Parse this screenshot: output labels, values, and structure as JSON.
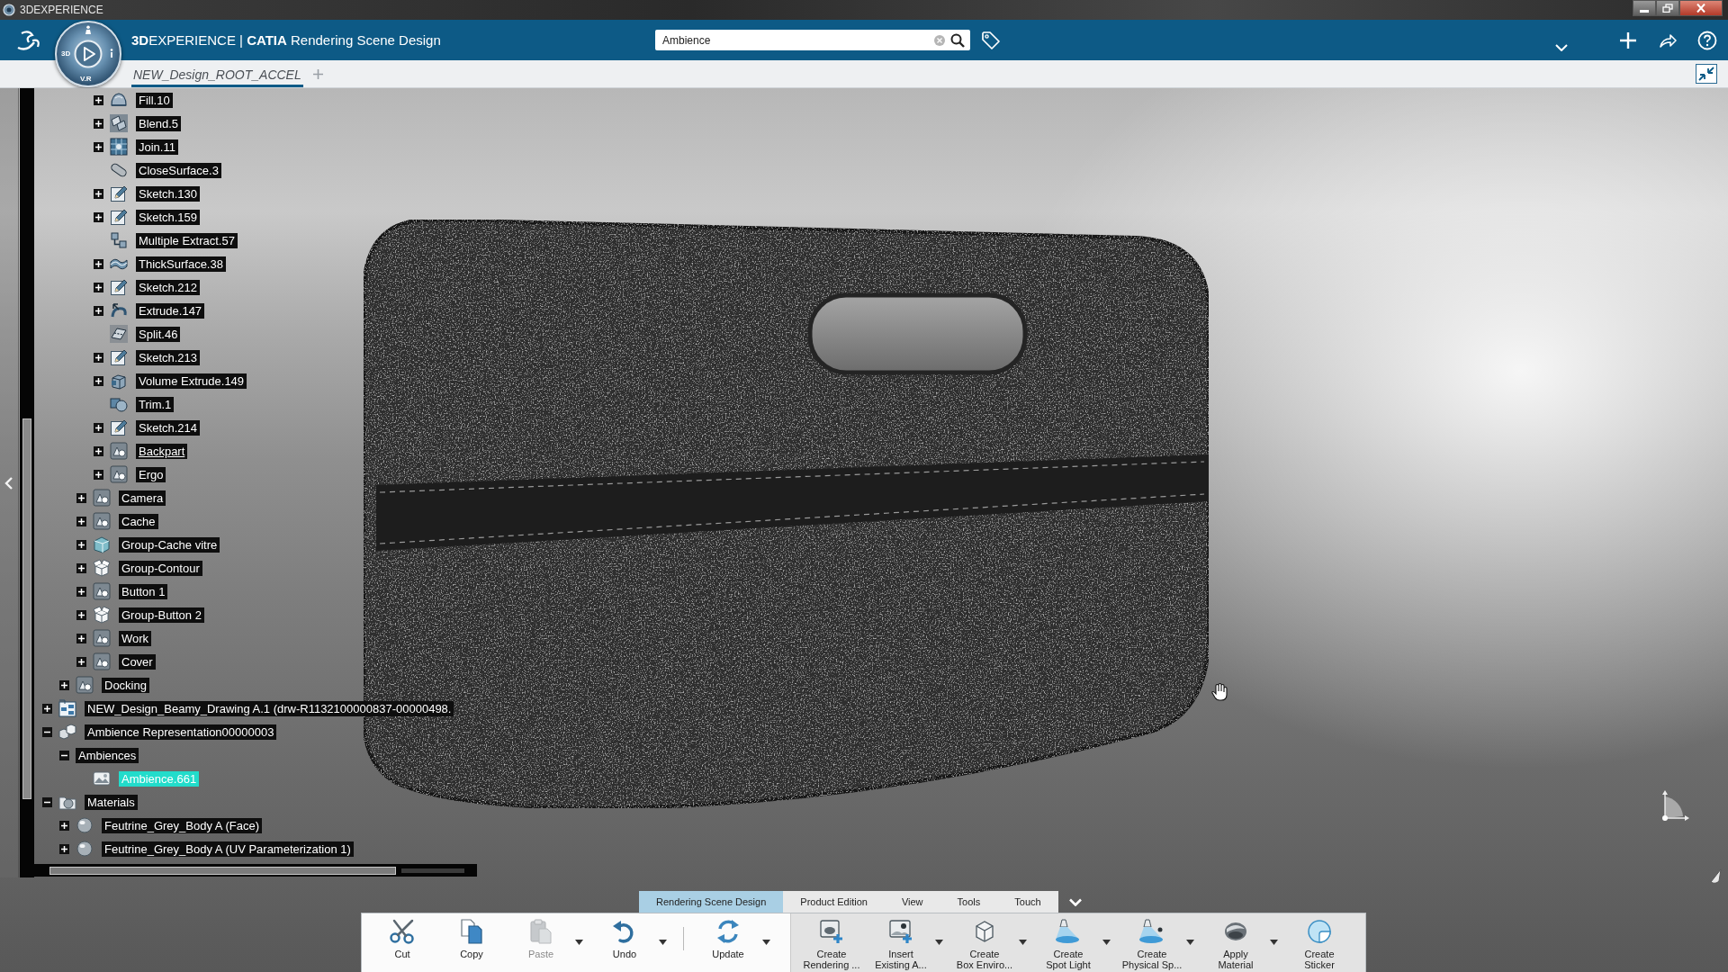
{
  "window": {
    "title": "3DEXPERIENCE"
  },
  "header": {
    "title": "**3D**EXPERIENCE | **CATIA** Rendering Scene Design",
    "search": {
      "value": "Ambience"
    }
  },
  "compass": {
    "left_label": "3D",
    "bottom_label": "V.R"
  },
  "document_tabs": [
    {
      "label": "NEW_Design_ROOT_ACCEL",
      "selected": true
    }
  ],
  "tree": {
    "items": [
      {
        "children": [
          {
            "children": [
              {
                "children": [
                  {
                    "label": "Fill.10",
                    "kind": "fill",
                    "expanded": false,
                    "selected": false,
                    "in_work": false
                  },
                  {
                    "label": "Blend.5",
                    "kind": "blend",
                    "expanded": false,
                    "selected": false,
                    "in_work": false
                  },
                  {
                    "label": "Join.11",
                    "kind": "join",
                    "expanded": false,
                    "selected": false,
                    "in_work": false
                  },
                  {
                    "label": "CloseSurface.3",
                    "kind": "close-surface",
                    "selected": false,
                    "in_work": false
                  },
                  {
                    "label": "Sketch.130",
                    "kind": "sketch",
                    "expanded": false,
                    "selected": false,
                    "in_work": false
                  },
                  {
                    "label": "Sketch.159",
                    "kind": "sketch",
                    "expanded": false,
                    "selected": false,
                    "in_work": false
                  },
                  {
                    "label": "Multiple Extract.57",
                    "kind": "extract",
                    "selected": false,
                    "in_work": false
                  },
                  {
                    "label": "ThickSurface.38",
                    "kind": "thick-surface",
                    "expanded": false,
                    "selected": false,
                    "in_work": false
                  },
                  {
                    "label": "Sketch.212",
                    "kind": "sketch",
                    "expanded": false,
                    "selected": false,
                    "in_work": false
                  },
                  {
                    "label": "Extrude.147",
                    "kind": "extrude",
                    "expanded": false,
                    "selected": false,
                    "in_work": false
                  },
                  {
                    "label": "Split.46",
                    "kind": "split",
                    "selected": false,
                    "in_work": false
                  },
                  {
                    "label": "Sketch.213",
                    "kind": "sketch",
                    "expanded": false,
                    "selected": false,
                    "in_work": false
                  },
                  {
                    "label": "Volume Extrude.149",
                    "kind": "volume-extrude",
                    "expanded": false,
                    "selected": false,
                    "in_work": false
                  },
                  {
                    "label": "Trim.1",
                    "kind": "trim",
                    "selected": false,
                    "in_work": false
                  },
                  {
                    "label": "Sketch.214",
                    "kind": "sketch",
                    "expanded": false,
                    "selected": false,
                    "in_work": false
                  },
                  {
                    "label": "Backpart",
                    "kind": "geometric-set",
                    "expanded": false,
                    "selected": false,
                    "in_work": true
                  },
                  {
                    "label": "Ergo",
                    "kind": "geometric-set",
                    "expanded": false,
                    "selected": false,
                    "in_work": false
                  }
                ]
              },
              {
                "label": "Camera",
                "kind": "geometric-set",
                "expanded": false,
                "selected": false,
                "in_work": false
              },
              {
                "label": "Cache",
                "kind": "geometric-set",
                "expanded": false,
                "selected": false,
                "in_work": false
              },
              {
                "label": "Group-Cache vitre",
                "kind": "glass-group",
                "expanded": false,
                "selected": false,
                "in_work": false
              },
              {
                "label": "Group-Contour",
                "kind": "group",
                "expanded": false,
                "selected": false,
                "in_work": false
              },
              {
                "label": "Button 1",
                "kind": "geometric-set",
                "expanded": false,
                "selected": false,
                "in_work": false
              },
              {
                "label": "Group-Button 2",
                "kind": "group",
                "expanded": false,
                "selected": false,
                "in_work": false
              },
              {
                "label": "Work",
                "kind": "geometric-set",
                "expanded": false,
                "selected": false,
                "in_work": false
              },
              {
                "label": "Cover",
                "kind": "geometric-set",
                "expanded": false,
                "selected": false,
                "in_work": false
              }
            ]
          },
          {
            "label": "Docking",
            "kind": "geometric-set",
            "expanded": false,
            "selected": false,
            "in_work": false
          }
        ]
      },
      {
        "label": "NEW_Design_Beamy_Drawing A.1 (drw-R1132100000837-00000498.",
        "kind": "drawing",
        "expanded": false,
        "selected": false,
        "in_work": false
      },
      {
        "label": "Ambience Representation00000003",
        "kind": "ambience-representation",
        "expanded": true,
        "selected": false,
        "in_work": false,
        "children": [
          {
            "label": "Ambiences",
            "expanded": true,
            "selected": false,
            "in_work": false,
            "children": [
              {
                "label": "Ambience.661",
                "kind": "ambience",
                "selected": true,
                "in_work": false
              }
            ]
          }
        ]
      },
      {
        "label": "Materials",
        "kind": "materials",
        "expanded": true,
        "selected": false,
        "in_work": false,
        "children": [
          {
            "label": "Feutrine_Grey_Body A (Face)",
            "kind": "material",
            "expanded": false,
            "selected": false,
            "in_work": false
          },
          {
            "label": "Feutrine_Grey_Body A (UV Parameterization 1)",
            "kind": "material",
            "expanded": false,
            "selected": false,
            "in_work": false
          }
        ]
      }
    ]
  },
  "action_bar": {
    "tabs": [
      {
        "label": "Rendering Scene Design",
        "selected": true
      },
      {
        "label": "Product Edition",
        "selected": false
      },
      {
        "label": "View",
        "selected": false
      },
      {
        "label": "Tools",
        "selected": false
      },
      {
        "label": "Touch",
        "selected": false
      }
    ],
    "sections": [
      {
        "groups": [
          {
            "tools": [
              {
                "kind": "cut",
                "label": "Cut",
                "disabled": false,
                "menu": false
              },
              {
                "kind": "copy",
                "label": "Copy",
                "disabled": false,
                "menu": false
              },
              {
                "kind": "paste",
                "label": "Paste",
                "disabled": true,
                "menu": true
              },
              {
                "kind": "undo",
                "label": "Undo",
                "disabled": false,
                "menu": true
              }
            ]
          },
          {
            "tools": [
              {
                "kind": "update",
                "label": "Update",
                "disabled": false,
                "menu": true
              }
            ]
          }
        ]
      },
      {
        "groups": [
          {
            "tools": [
              {
                "kind": "create-rendering",
                "label": "Create\nRendering ...",
                "disabled": false,
                "menu": false
              },
              {
                "kind": "insert-ambience",
                "label": "Insert\nExisting A...",
                "disabled": false,
                "menu": true
              },
              {
                "kind": "box-environment",
                "label": "Create\nBox Enviro...",
                "disabled": false,
                "menu": true
              },
              {
                "kind": "spot-light",
                "label": "Create\nSpot Light",
                "disabled": false,
                "menu": true
              },
              {
                "kind": "physical-spot",
                "label": "Create\nPhysical Sp...",
                "disabled": false,
                "menu": true
              },
              {
                "kind": "apply-material",
                "label": "Apply\nMaterial",
                "disabled": false,
                "menu": true
              },
              {
                "kind": "sticker",
                "label": "Create\nSticker",
                "disabled": false,
                "menu": false
              }
            ]
          }
        ]
      }
    ]
  }
}
